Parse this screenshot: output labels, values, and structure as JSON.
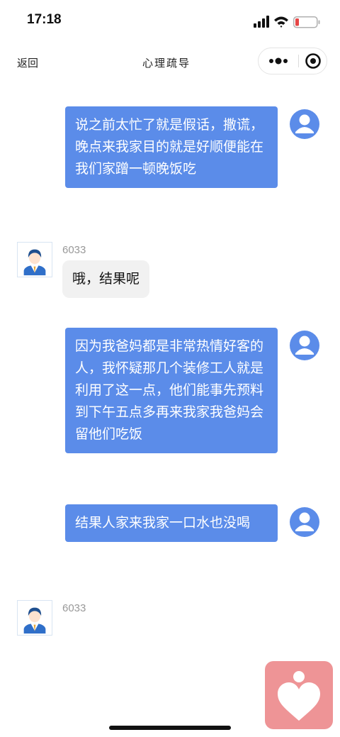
{
  "status_bar": {
    "time": "17:18"
  },
  "nav": {
    "back_label": "返回",
    "title": "心理疏导",
    "more_icon": "more-dots-icon",
    "close_icon": "record-target-icon"
  },
  "messages": [
    {
      "direction": "outgoing",
      "text": "说之前太忙了就是假话，撒谎，晚点来我家目的就是好顺便能在我们家蹭一顿晚饭吃"
    },
    {
      "direction": "incoming",
      "sender": "6033",
      "text": "哦，结果呢"
    },
    {
      "direction": "outgoing",
      "text": "因为我爸妈都是非常热情好客的人，我怀疑那几个装修工人就是利用了这一点，他们能事先预料到下午五点多再来我家我爸妈会留他们吃饭"
    },
    {
      "direction": "outgoing",
      "text": "结果人家来我家一口水也没喝"
    },
    {
      "direction": "incoming",
      "sender": "6033",
      "text": ""
    }
  ],
  "colors": {
    "outgoing_bubble": "#5b8ce9",
    "incoming_bubble": "#f1f1f1",
    "heart_button": "#ee9496",
    "user_avatar": "#5b8ce9"
  },
  "floating_button": {
    "icon": "heart-person-icon"
  }
}
